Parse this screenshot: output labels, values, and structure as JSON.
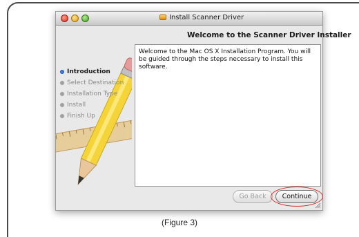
{
  "window": {
    "title": "Install Scanner Driver",
    "header": "Welcome to the Scanner Driver Installer"
  },
  "steps": [
    {
      "label": "Introduction",
      "active": true
    },
    {
      "label": "Select Destination",
      "active": false
    },
    {
      "label": "Installation Type",
      "active": false
    },
    {
      "label": "Install",
      "active": false
    },
    {
      "label": "Finish Up",
      "active": false
    }
  ],
  "content": {
    "welcome_text": "Welcome to the Mac OS X Installation Program. You will be guided through the steps necessary to install this software."
  },
  "buttons": {
    "go_back": "Go Back",
    "continue": "Continue"
  },
  "caption": "(Figure 3)",
  "colors": {
    "highlight": "#d32a2a",
    "active_step": "#3d7be0"
  },
  "icons": [
    "close-icon",
    "minimize-icon",
    "zoom-icon",
    "installer-disk-icon",
    "resize-grip-icon"
  ]
}
